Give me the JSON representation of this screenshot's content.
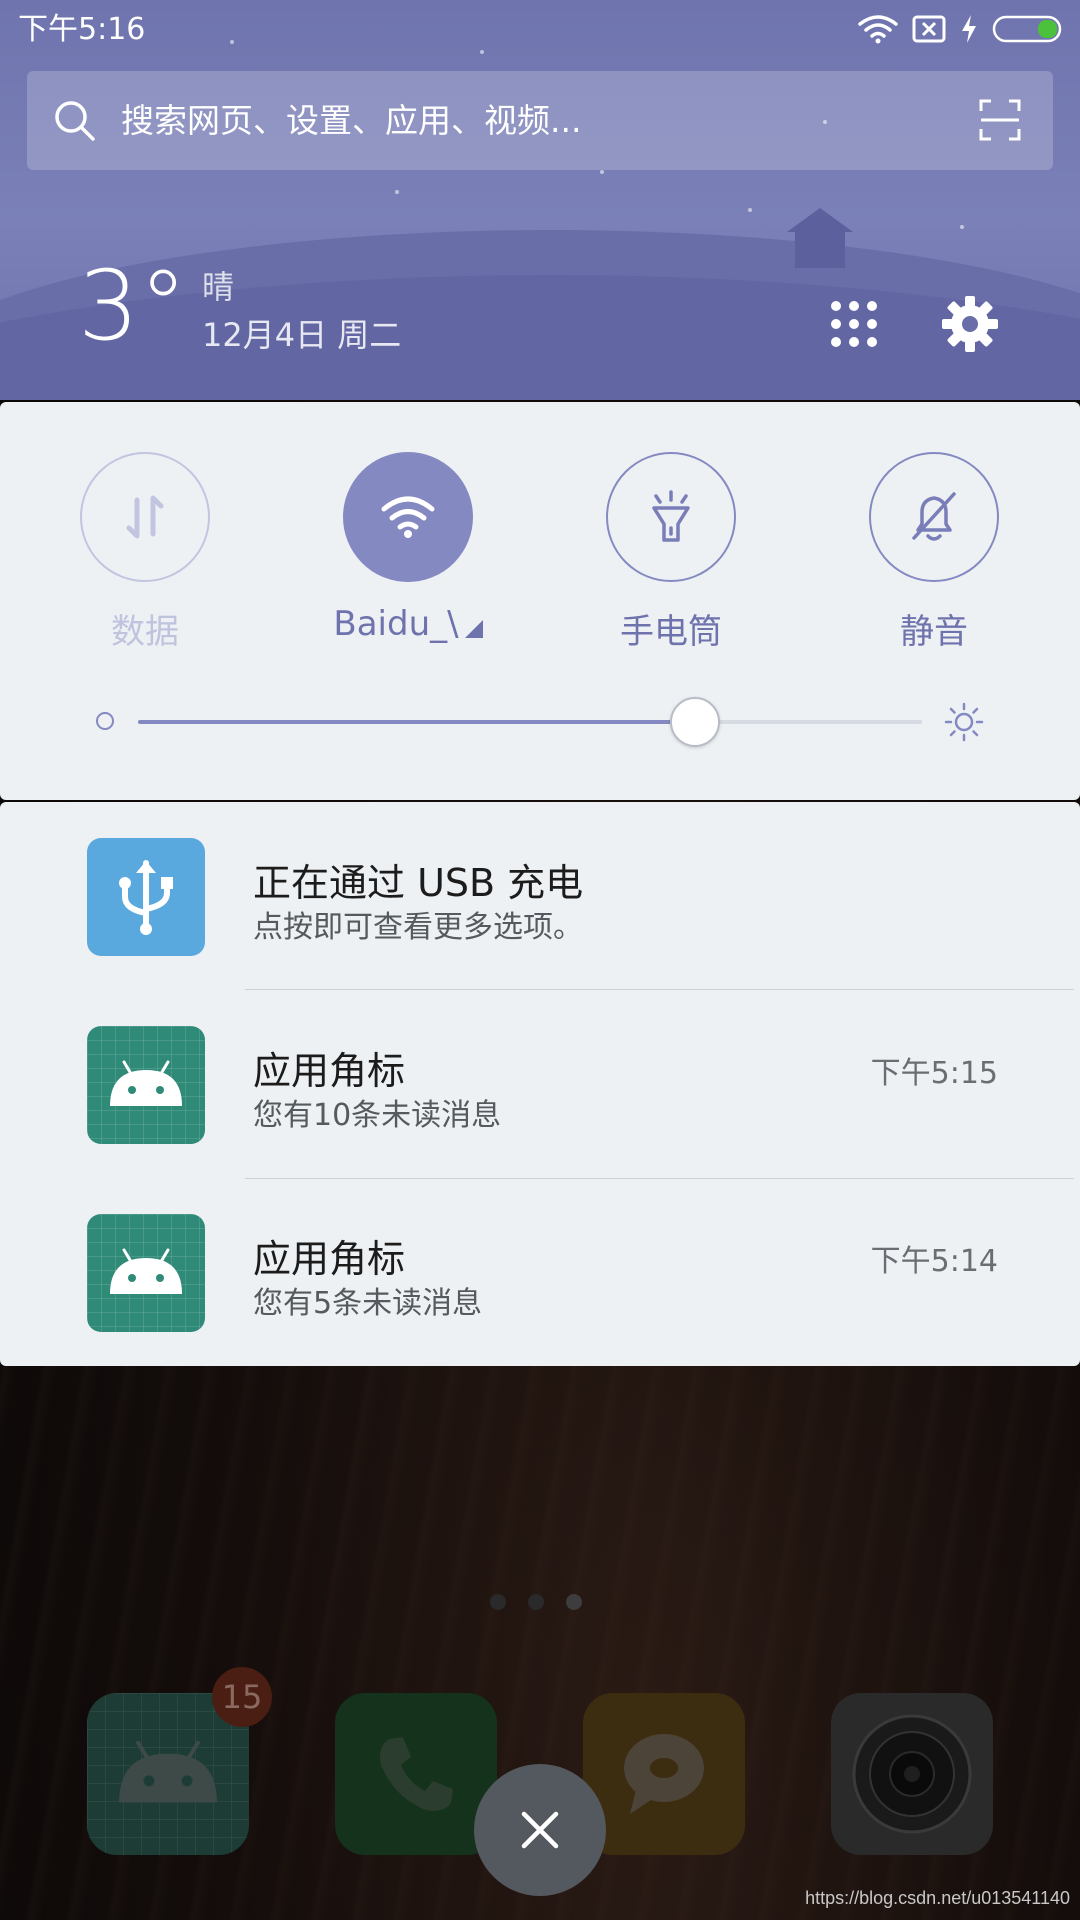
{
  "status_bar": {
    "time": "下午5:16",
    "icons": [
      "wifi-icon",
      "no-sim-icon",
      "charging-icon",
      "battery-icon"
    ]
  },
  "search": {
    "placeholder": "搜索网页、设置、应用、视频..."
  },
  "weather": {
    "temperature": "3°",
    "condition": "晴",
    "date": "12月4日 周二"
  },
  "quick_settings": {
    "toggles": [
      {
        "id": "data",
        "label": "数据",
        "state": "off",
        "icon": "data-arrows-icon"
      },
      {
        "id": "wifi",
        "label": "Baidu_\\",
        "state": "on",
        "icon": "wifi-icon"
      },
      {
        "id": "flashlight",
        "label": "手电筒",
        "state": "off",
        "icon": "flashlight-icon"
      },
      {
        "id": "mute",
        "label": "静音",
        "state": "off",
        "icon": "bell-off-icon"
      }
    ],
    "brightness": 0.71
  },
  "notifications": [
    {
      "title": "正在通过 USB 充电",
      "text": "点按即可查看更多选项。",
      "time": "",
      "icon": "usb-icon"
    },
    {
      "title": "应用角标",
      "text": "您有10条未读消息",
      "time": "下午5:15",
      "icon": "android-icon"
    },
    {
      "title": "应用角标",
      "text": "您有5条未读消息",
      "time": "下午5:14",
      "icon": "android-icon"
    }
  ],
  "home": {
    "page_count": 3,
    "active_page": 2,
    "dock": [
      {
        "id": "android-app",
        "badge": "15",
        "icon": "android-icon"
      },
      {
        "id": "phone",
        "icon": "phone-icon"
      },
      {
        "id": "messages",
        "icon": "message-icon"
      },
      {
        "id": "camera",
        "icon": "camera-icon"
      }
    ]
  },
  "colors": {
    "accent": "#8589c2",
    "header": "#7378b2",
    "panel": "#edf1f4"
  },
  "watermark": "https://blog.csdn.net/u013541140"
}
